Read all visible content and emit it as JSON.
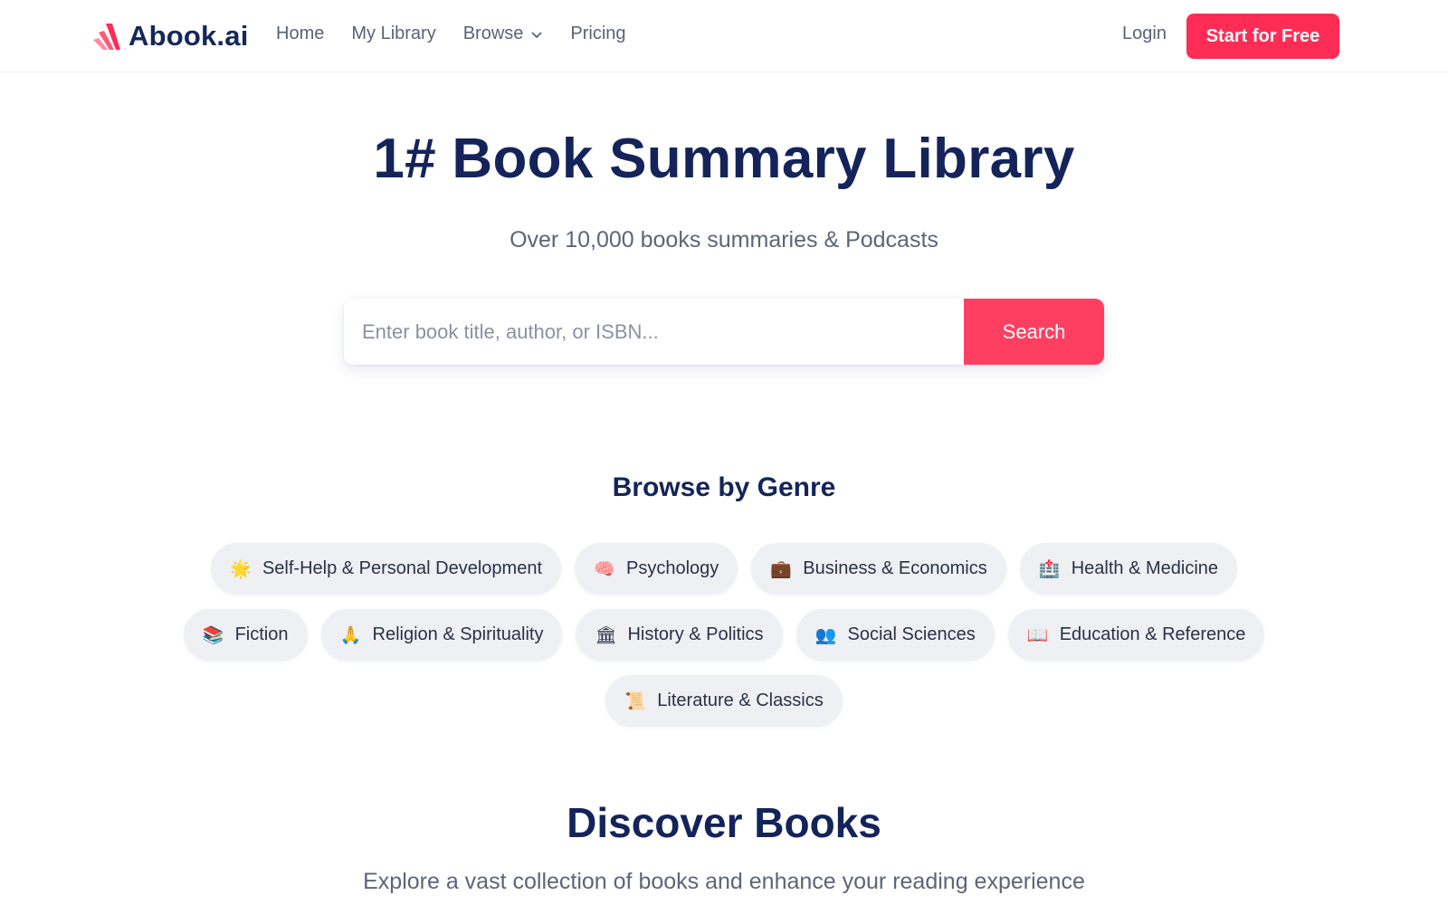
{
  "header": {
    "logo_text": "Abook.ai",
    "nav": [
      {
        "label": "Home"
      },
      {
        "label": "My Library"
      },
      {
        "label": "Browse"
      },
      {
        "label": "Pricing"
      }
    ],
    "login_label": "Login",
    "cta_label": "Start for Free"
  },
  "hero": {
    "title": "1# Book Summary Library",
    "subtitle": "Over 10,000 books summaries & Podcasts",
    "search_placeholder": "Enter book title, author, or ISBN...",
    "search_button": "Search"
  },
  "genres": {
    "title": "Browse by Genre",
    "items": [
      {
        "icon": "🌟",
        "label": "Self-Help & Personal Development"
      },
      {
        "icon": "🧠",
        "label": "Psychology"
      },
      {
        "icon": "💼",
        "label": "Business & Economics"
      },
      {
        "icon": "🏥",
        "label": "Health & Medicine"
      },
      {
        "icon": "📚",
        "label": "Fiction"
      },
      {
        "icon": "🙏",
        "label": "Religion & Spirituality"
      },
      {
        "icon": "🏛",
        "label": "History & Politics"
      },
      {
        "icon": "👥",
        "label": "Social Sciences"
      },
      {
        "icon": "📖",
        "label": "Education & Reference"
      },
      {
        "icon": "📜",
        "label": "Literature & Classics"
      }
    ]
  },
  "discover": {
    "title": "Discover Books",
    "subtitle": "Explore a vast collection of books and enhance your reading experience"
  },
  "colors": {
    "accent": "#ff2d55",
    "search_button": "#ff3f61",
    "heading": "#14245a"
  }
}
